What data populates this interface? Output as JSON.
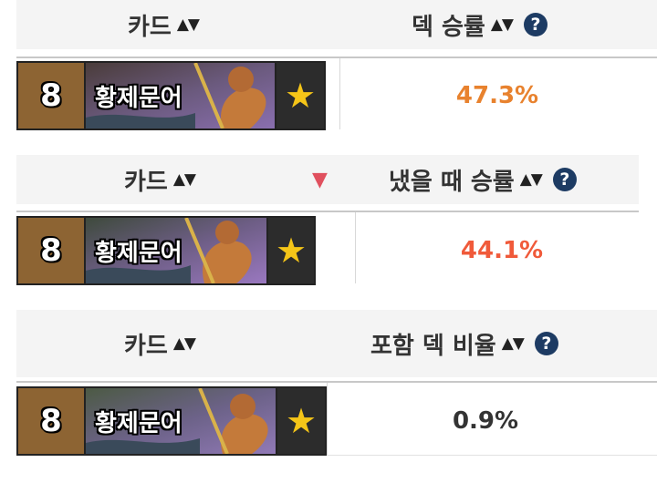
{
  "sections": [
    {
      "header": {
        "card_label": "카드",
        "card_sort": "▲▼",
        "stat_label": "덱 승률",
        "stat_sort": "▲▼",
        "help": "?"
      },
      "row": {
        "mana": "8",
        "card_name": "황제문어",
        "value": "47.3%",
        "value_color": "#e8822e"
      }
    },
    {
      "header": {
        "card_label": "카드",
        "card_sort": "▲▼",
        "stat_label": "냈을 때 승률",
        "stat_sort": "▲▼",
        "help": "?",
        "marker": "▼"
      },
      "row": {
        "mana": "8",
        "card_name": "황제문어",
        "value": "44.1%",
        "value_color": "#f05a3a"
      }
    },
    {
      "header": {
        "card_label": "카드",
        "card_sort": "▲▼",
        "stat_label": "포함 덱 비율",
        "stat_sort": "▲▼",
        "help": "?"
      },
      "row": {
        "mana": "8",
        "card_name": "황제문어",
        "value": "0.9%",
        "value_color": "#333333"
      }
    }
  ],
  "colors": {
    "header_bg": "#f4f4f4",
    "mana_bg": "#8d6433",
    "star": "#f5c518",
    "help_bg": "#1d3b63",
    "marker": "#e0505e"
  },
  "icons": {
    "star": "star-icon",
    "help": "help-circle-icon",
    "sort": "sort-arrows-icon"
  }
}
